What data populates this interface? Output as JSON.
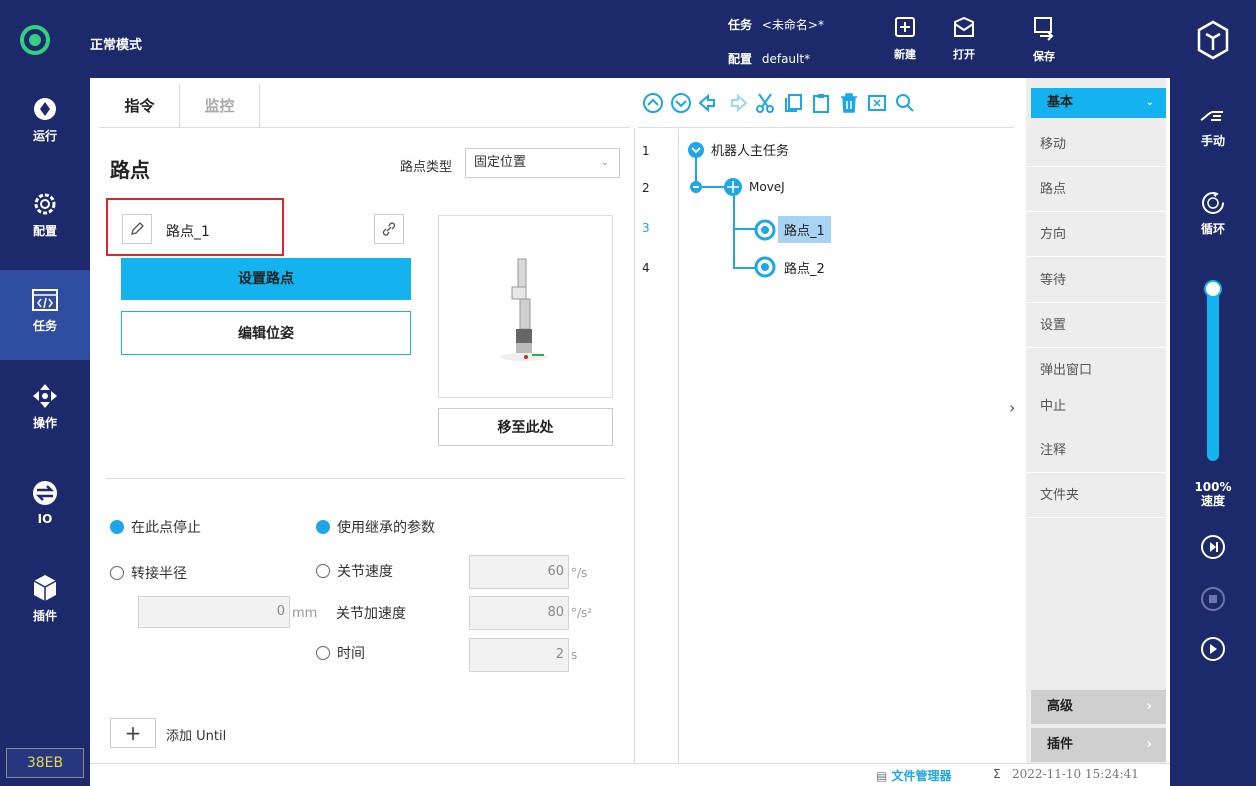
{
  "top": {
    "mode": "正常模式",
    "task_label": "任务",
    "task_value": "<未命名>*",
    "config_label": "配置",
    "config_value": "default*",
    "new": "新建",
    "open": "打开",
    "save": "保存"
  },
  "nav": [
    "运行",
    "配置",
    "任务",
    "操作",
    "IO",
    "插件"
  ],
  "status_code": "38EB",
  "tabs": [
    "指令",
    "监控"
  ],
  "waypoint": {
    "title": "路点",
    "type_label": "路点类型",
    "type_value": "固定位置",
    "name": "路点_1",
    "set_button": "设置路点",
    "edit_button": "编辑位姿",
    "move_button": "移至此处"
  },
  "params": {
    "stop_here": "在此点停止",
    "blend_radius": "转接半径",
    "radius_value": "0",
    "radius_unit": "mm",
    "inherit": "使用继承的参数",
    "joint_speed": "关节速度",
    "joint_speed_value": "60",
    "joint_speed_unit": "°/s",
    "joint_acc": "关节加速度",
    "joint_acc_value": "80",
    "joint_acc_unit": "°/s²",
    "time": "时间",
    "time_value": "2",
    "time_unit": "s",
    "add_until": "添加 Until"
  },
  "tree": {
    "lines": [
      "1",
      "2",
      "3",
      "4"
    ],
    "items": [
      "机器人主任务",
      "MoveJ",
      "路点_1",
      "路点_2"
    ]
  },
  "library": {
    "header": "基本",
    "items": [
      "移动",
      "路点",
      "方向",
      "等待",
      "设置",
      "弹出窗口",
      "中止",
      "注释",
      "文件夹"
    ],
    "advanced": "高级",
    "plugins": "插件"
  },
  "right": {
    "manual": "手动",
    "loop": "循环",
    "speed": "100%",
    "speed_label": "速度",
    "speed_level": 1.0
  },
  "footer": {
    "file_manager": "文件管理器",
    "datetime": "2022-11-10 15:24:41"
  }
}
